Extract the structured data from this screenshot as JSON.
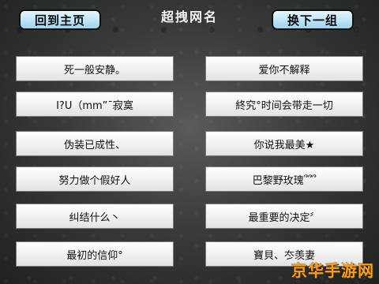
{
  "header": {
    "home_label": "回到主页",
    "title": "超拽网名",
    "next_label": "换下一组"
  },
  "names": {
    "left": [
      "死一般安静。",
      "I?U（mm”¯寂寞",
      "伪装已成性、",
      "努力做个假好人",
      "纠结什么丶",
      "最初的信仰°"
    ],
    "right": [
      "爱你不解释",
      "終究°时间会带走一切",
      "你说我最美★",
      "巴黎野玫瑰՞՞՞",
      "最重要的决定〞",
      "寶貝、冭羡妻"
    ]
  },
  "watermark": "京华手游网"
}
